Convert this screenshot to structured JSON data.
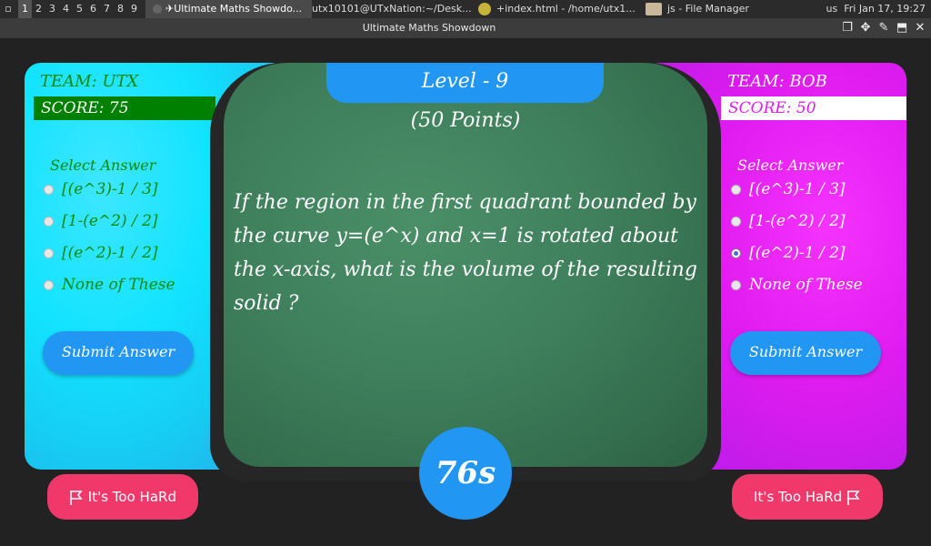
{
  "taskbar": {
    "workspaces": [
      "1",
      "2",
      "3",
      "4",
      "5",
      "6",
      "7",
      "8",
      "9"
    ],
    "tasks": [
      "✈Ultimate Maths Showdo...",
      "utx10101@UTxNation:~/Desk...",
      "+index.html - /home/utx1...",
      "js - File Manager"
    ],
    "layout": "us",
    "clock": "Fri Jan 17, 19:27"
  },
  "window": {
    "title": "Ultimate Maths Showdown"
  },
  "left_team": {
    "team": "TEAM: UTX",
    "score": "SCORE: 75",
    "select_title": "Select Answer",
    "options": [
      "[(e^3)-1 / 3]",
      "[1-(e^2) / 2]",
      "[(e^2)-1 / 2]",
      "None of These"
    ],
    "selected": null,
    "submit": "Submit Answer",
    "hard": "It's Too HaRd"
  },
  "right_team": {
    "team": "TEAM: BOB",
    "score": "SCORE: 50",
    "select_title": "Select Answer",
    "options": [
      "[(e^3)-1 / 3]",
      "[1-(e^2) / 2]",
      "[(e^2)-1 / 2]",
      "None of These"
    ],
    "selected": 2,
    "submit": "Submit Answer",
    "hard": "It's Too HaRd"
  },
  "board": {
    "level": "Level - 9",
    "points": "(50 Points)",
    "question": "If the region in the first quadrant bounded by the curve y=(e^x) and x=1 is rotated about the x-axis, what is the volume of the resulting solid ?"
  },
  "timer": "76s",
  "colors": {
    "left_accent": "#12e3ff",
    "right_accent": "#e01cf0",
    "blue": "#2196f3",
    "hard_pink": "#f0386b",
    "left_score_bg": "#008000",
    "left_text": "#0a8a0a",
    "board_green": "#3f7f5c"
  }
}
